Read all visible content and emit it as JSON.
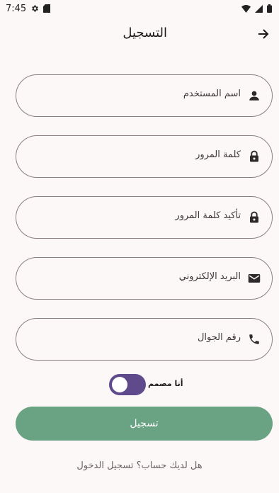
{
  "status_bar": {
    "time": "7:45",
    "icons_left": [
      "gear-icon",
      "sd-card-icon"
    ],
    "icons_right": [
      "wifi-icon",
      "signal-icon",
      "battery-icon"
    ]
  },
  "app_bar": {
    "title": "التسجيل",
    "back_icon": "arrow-right-icon"
  },
  "form": {
    "fields": [
      {
        "label": "اسم المستخدم",
        "icon": "person-icon"
      },
      {
        "label": "كلمة المرور",
        "icon": "lock-icon"
      },
      {
        "label": "تأكيد كلمة المرور",
        "icon": "lock-icon"
      },
      {
        "label": "البريد الإلكتروني",
        "icon": "mail-icon"
      },
      {
        "label": "رقم الجوال",
        "icon": "phone-icon"
      }
    ],
    "designer_toggle": {
      "label": "أنا مصمم",
      "checked": true
    },
    "submit_label": "تسجيل",
    "login_prompt": "هل لديك حساب؟ تسجيل الدخول"
  },
  "colors": {
    "background": "#fdf8f8",
    "primary_button": "#6aa383",
    "toggle_track": "#5f4b8b",
    "field_border": "#8a7f80"
  }
}
